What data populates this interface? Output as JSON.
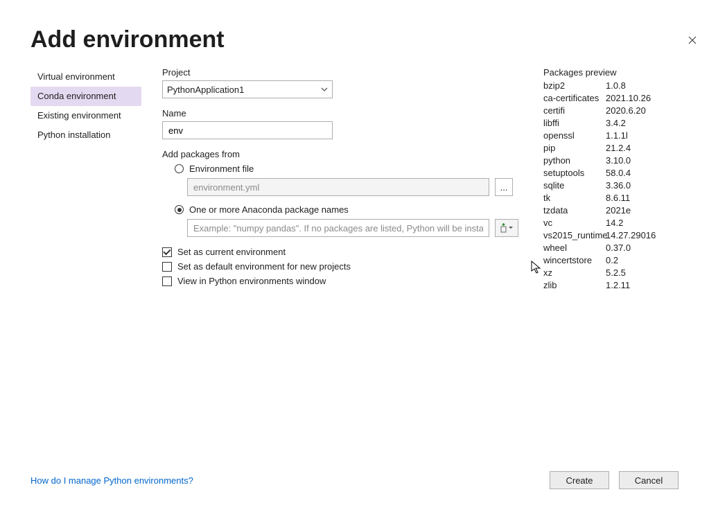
{
  "title": "Add environment",
  "sidebar": {
    "items": [
      {
        "label": "Virtual environment"
      },
      {
        "label": "Conda environment"
      },
      {
        "label": "Existing environment"
      },
      {
        "label": "Python installation"
      }
    ],
    "selected_index": 1
  },
  "form": {
    "project_label": "Project",
    "project_value": "PythonApplication1",
    "name_label": "Name",
    "name_value": "env",
    "add_packages_label": "Add packages from",
    "env_file_option": "Environment file",
    "env_file_placeholder": "environment.yml",
    "package_names_option": "One or more Anaconda package names",
    "package_names_placeholder": "Example: \"numpy pandas\". If no packages are listed, Python will be installed",
    "selected_option": "package_names",
    "browse_btn": "...",
    "cb_set_current": "Set as current environment",
    "cb_set_default": "Set as default environment for new projects",
    "cb_view_window": "View in Python environments window",
    "cb_set_current_checked": true,
    "cb_set_default_checked": false,
    "cb_view_window_checked": false
  },
  "packages": {
    "header": "Packages preview",
    "items": [
      {
        "name": "bzip2",
        "version": "1.0.8"
      },
      {
        "name": "ca-certificates",
        "version": "2021.10.26"
      },
      {
        "name": "certifi",
        "version": "2020.6.20"
      },
      {
        "name": "libffi",
        "version": "3.4.2"
      },
      {
        "name": "openssl",
        "version": "1.1.1l"
      },
      {
        "name": "pip",
        "version": "21.2.4"
      },
      {
        "name": "python",
        "version": "3.10.0"
      },
      {
        "name": "setuptools",
        "version": "58.0.4"
      },
      {
        "name": "sqlite",
        "version": "3.36.0"
      },
      {
        "name": "tk",
        "version": "8.6.11"
      },
      {
        "name": "tzdata",
        "version": "2021e"
      },
      {
        "name": "vc",
        "version": "14.2"
      },
      {
        "name": "vs2015_runtime",
        "version": "14.27.29016"
      },
      {
        "name": "wheel",
        "version": "0.37.0"
      },
      {
        "name": "wincertstore",
        "version": "0.2"
      },
      {
        "name": "xz",
        "version": "5.2.5"
      },
      {
        "name": "zlib",
        "version": "1.2.11"
      }
    ]
  },
  "footer": {
    "help_link": "How do I manage Python environments?",
    "create_btn": "Create",
    "cancel_btn": "Cancel"
  }
}
